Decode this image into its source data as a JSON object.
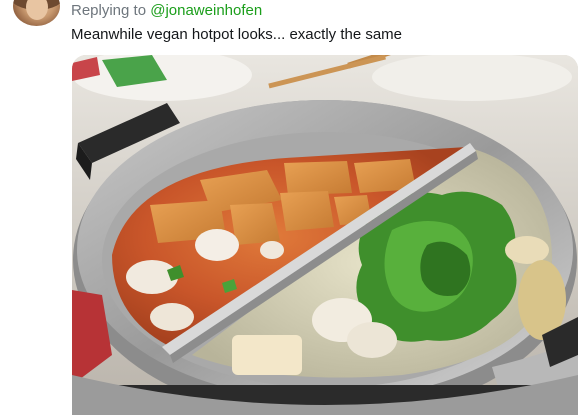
{
  "tweet": {
    "replying_prefix": "Replying to ",
    "replying_handle": "@jonaweinhofen",
    "text": "Meanwhile vegan hotpot looks... exactly the same"
  },
  "colors": {
    "handle": "#1b9e1b",
    "muted": "#6e767d",
    "text": "#14171a"
  },
  "media": {
    "description_icon": "hotpot-photo"
  }
}
